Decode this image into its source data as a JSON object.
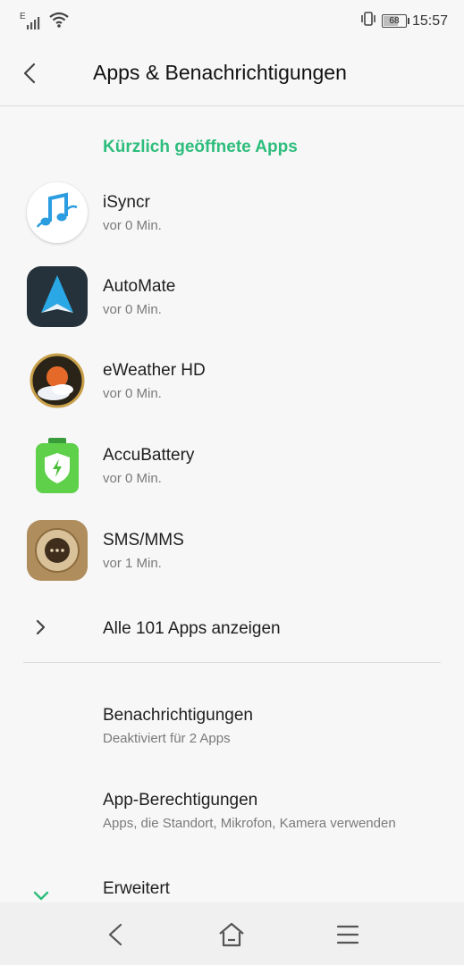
{
  "status_bar": {
    "network_type": "E",
    "battery_level": "68",
    "battery_fraction": 0.68,
    "time": "15:57",
    "icons": [
      "signal-icon",
      "wifi-icon",
      "vibrate-icon",
      "battery-icon"
    ]
  },
  "header": {
    "title": "Apps & Benachrichtigungen",
    "back_icon": "back-arrow-icon"
  },
  "recent_section": {
    "title": "Kürzlich geöffnete Apps",
    "apps": [
      {
        "name": "iSyncr",
        "time": "vor 0 Min.",
        "icon": "isyncr-icon"
      },
      {
        "name": "AutoMate",
        "time": "vor 0 Min.",
        "icon": "automate-icon"
      },
      {
        "name": "eWeather HD",
        "time": "vor 0 Min.",
        "icon": "eweather-icon"
      },
      {
        "name": "AccuBattery",
        "time": "vor 0 Min.",
        "icon": "accubattery-icon"
      },
      {
        "name": "SMS/MMS",
        "time": "vor 1 Min.",
        "icon": "sms-icon"
      }
    ],
    "show_all_label": "Alle 101 Apps anzeigen"
  },
  "settings": {
    "notifications": {
      "title": "Benachrichtigungen",
      "subtitle": "Deaktiviert für 2 Apps"
    },
    "permissions": {
      "title": "App-Berechtigungen",
      "subtitle": "Apps, die Standort, Mikrofon, Kamera verwenden"
    },
    "advanced": {
      "title": "Erweitert"
    }
  },
  "nav_bar": {
    "buttons": [
      "back-icon",
      "home-icon",
      "menu-icon"
    ]
  },
  "colors": {
    "accent": "#2dbd7c",
    "background": "#f7f7f7",
    "text_primary": "#1e1e1e",
    "text_secondary": "#7a7a7a"
  }
}
